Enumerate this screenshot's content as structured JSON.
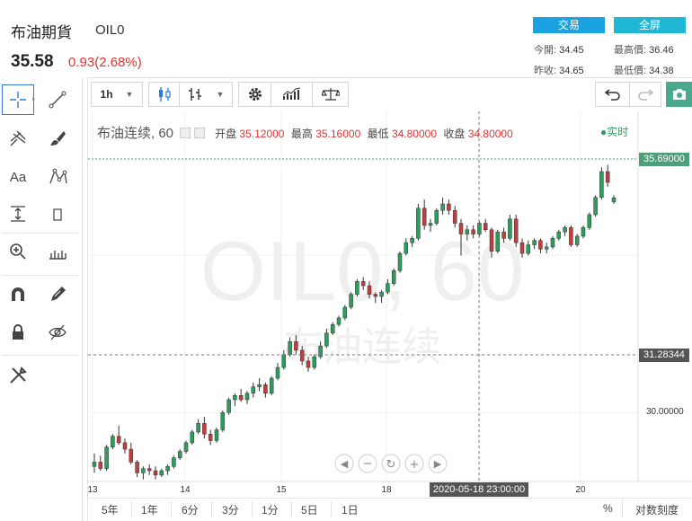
{
  "header": {
    "title": "布油期貨",
    "code": "OIL0",
    "price": "35.58",
    "change": "0.93(2.68%)",
    "trade_button": "交易",
    "fullscreen_button": "全屏",
    "stats": {
      "open_label": "今開:",
      "open_value": "34.45",
      "high_label": "最高價:",
      "high_value": "36.46",
      "prev_close_label": "昨收:",
      "prev_close_value": "34.65",
      "low_label": "最低價:",
      "low_value": "34.38"
    }
  },
  "toolbar": {
    "interval": "1h"
  },
  "legend": {
    "symbol": "布油连续, 60",
    "open_label": "开盘",
    "open_value": "35.12000",
    "high_label": "最高",
    "high_value": "35.16000",
    "low_label": "最低",
    "low_value": "34.80000",
    "close_label": "收盘",
    "close_value": "34.80000",
    "realtime_label": "实时"
  },
  "watermark": {
    "line1": "OIL0, 60",
    "line2": "布油连续"
  },
  "price_axis": {
    "current_price": "35.69000",
    "crosshair_price": "31.28344",
    "tick": "30.00000"
  },
  "time_axis": {
    "ticks": [
      "13",
      "14",
      "15",
      "18",
      "19",
      "20"
    ],
    "crosshair_label": "2020-05-18 23:00:00"
  },
  "bottom_bar": {
    "ranges": [
      "5年",
      "1年",
      "6分",
      "3分",
      "1分",
      "5日",
      "1日"
    ],
    "percent": "%",
    "log_scale": "对数刻度"
  },
  "colors": {
    "up": "#2e9c5c",
    "down": "#c43c3c",
    "accent": "#1aa3e0",
    "price_label": "#4f9e7a"
  },
  "chart_data": {
    "type": "candlestick",
    "ylim": [
      29.1,
      37.7
    ],
    "ohlc": [
      [
        29.45,
        29.75,
        29.3,
        29.55
      ],
      [
        29.55,
        29.7,
        29.35,
        29.4
      ],
      [
        29.4,
        29.95,
        29.35,
        29.9
      ],
      [
        29.9,
        30.2,
        29.85,
        30.15
      ],
      [
        30.15,
        30.4,
        29.95,
        30.0
      ],
      [
        30.0,
        30.1,
        29.75,
        29.85
      ],
      [
        29.85,
        30.0,
        29.5,
        29.55
      ],
      [
        29.55,
        29.6,
        29.2,
        29.3
      ],
      [
        29.3,
        29.45,
        29.15,
        29.4
      ],
      [
        29.4,
        29.5,
        29.25,
        29.35
      ],
      [
        29.35,
        29.45,
        29.15,
        29.25
      ],
      [
        29.25,
        29.4,
        29.2,
        29.35
      ],
      [
        29.35,
        29.5,
        29.25,
        29.45
      ],
      [
        29.45,
        29.7,
        29.4,
        29.65
      ],
      [
        29.65,
        29.85,
        29.6,
        29.8
      ],
      [
        29.8,
        30.05,
        29.75,
        30.0
      ],
      [
        30.0,
        30.3,
        29.95,
        30.25
      ],
      [
        30.25,
        30.55,
        30.2,
        30.45
      ],
      [
        30.45,
        30.6,
        30.1,
        30.2
      ],
      [
        30.2,
        30.3,
        29.95,
        30.05
      ],
      [
        30.05,
        30.35,
        30.0,
        30.3
      ],
      [
        30.3,
        30.75,
        30.25,
        30.7
      ],
      [
        30.7,
        31.05,
        30.65,
        31.0
      ],
      [
        31.0,
        31.15,
        30.85,
        31.1
      ],
      [
        31.1,
        31.25,
        30.95,
        31.0
      ],
      [
        31.0,
        31.2,
        30.9,
        31.15
      ],
      [
        31.15,
        31.4,
        31.05,
        31.3
      ],
      [
        31.3,
        31.5,
        31.2,
        31.35
      ],
      [
        31.35,
        31.4,
        31.05,
        31.15
      ],
      [
        31.15,
        31.55,
        31.1,
        31.5
      ],
      [
        31.5,
        31.85,
        31.45,
        31.75
      ],
      [
        31.75,
        32.15,
        31.7,
        32.05
      ],
      [
        32.05,
        32.45,
        32.0,
        32.35
      ],
      [
        32.35,
        32.5,
        32.05,
        32.15
      ],
      [
        32.15,
        32.25,
        31.8,
        31.9
      ],
      [
        31.9,
        32.0,
        31.65,
        31.75
      ],
      [
        31.75,
        32.05,
        31.7,
        32.0
      ],
      [
        32.0,
        32.35,
        31.95,
        32.25
      ],
      [
        32.25,
        32.65,
        32.2,
        32.55
      ],
      [
        32.55,
        32.8,
        32.5,
        32.75
      ],
      [
        32.75,
        32.95,
        32.7,
        32.9
      ],
      [
        32.9,
        33.2,
        32.85,
        33.15
      ],
      [
        33.15,
        33.5,
        33.1,
        33.45
      ],
      [
        33.45,
        33.8,
        33.4,
        33.75
      ],
      [
        33.75,
        33.85,
        33.55,
        33.65
      ],
      [
        33.65,
        33.75,
        33.35,
        33.45
      ],
      [
        33.45,
        33.5,
        33.25,
        33.4
      ],
      [
        33.4,
        33.55,
        33.25,
        33.5
      ],
      [
        33.5,
        33.8,
        33.45,
        33.7
      ],
      [
        33.7,
        34.05,
        33.65,
        34.0
      ],
      [
        34.0,
        34.45,
        33.95,
        34.4
      ],
      [
        34.4,
        34.75,
        34.35,
        34.65
      ],
      [
        34.65,
        34.8,
        34.55,
        34.75
      ],
      [
        34.75,
        35.55,
        34.7,
        35.45
      ],
      [
        35.45,
        35.65,
        34.95,
        35.05
      ],
      [
        35.05,
        35.2,
        34.9,
        35.1
      ],
      [
        35.1,
        35.45,
        35.05,
        35.4
      ],
      [
        35.4,
        35.7,
        35.3,
        35.55
      ],
      [
        35.55,
        35.65,
        35.3,
        35.4
      ],
      [
        35.4,
        35.5,
        35.0,
        35.1
      ],
      [
        35.1,
        35.2,
        34.35,
        34.85
      ],
      [
        34.85,
        35.05,
        34.7,
        34.95
      ],
      [
        34.95,
        35.05,
        34.75,
        34.85
      ],
      [
        34.85,
        35.15,
        34.8,
        35.1
      ],
      [
        35.1,
        35.2,
        34.9,
        34.95
      ],
      [
        34.95,
        35.0,
        34.3,
        34.45
      ],
      [
        34.45,
        34.95,
        34.4,
        34.9
      ],
      [
        34.9,
        35.0,
        34.65,
        34.75
      ],
      [
        34.75,
        35.3,
        34.7,
        35.2
      ],
      [
        35.2,
        35.3,
        34.55,
        34.65
      ],
      [
        34.65,
        34.75,
        34.3,
        34.4
      ],
      [
        34.4,
        34.7,
        34.35,
        34.6
      ],
      [
        34.6,
        34.75,
        34.5,
        34.7
      ],
      [
        34.7,
        34.75,
        34.4,
        34.5
      ],
      [
        34.5,
        34.65,
        34.4,
        34.55
      ],
      [
        34.55,
        34.8,
        34.5,
        34.75
      ],
      [
        34.75,
        34.95,
        34.7,
        34.9
      ],
      [
        34.9,
        35.05,
        34.8,
        35.0
      ],
      [
        35.0,
        35.05,
        34.55,
        34.6
      ],
      [
        34.6,
        34.85,
        34.55,
        34.8
      ],
      [
        34.8,
        35.05,
        34.75,
        35.0
      ],
      [
        35.0,
        35.35,
        34.95,
        35.3
      ],
      [
        35.3,
        35.75,
        35.25,
        35.7
      ],
      [
        35.7,
        36.4,
        35.65,
        36.3
      ],
      [
        36.3,
        36.46,
        35.95,
        36.05
      ],
      [
        35.6,
        35.75,
        35.55,
        35.69
      ]
    ],
    "current_price": 35.69,
    "crosshair_price": 31.28344,
    "x_ticks": [
      "13",
      "14",
      "15",
      "18",
      "19",
      "20"
    ],
    "grid": true
  }
}
